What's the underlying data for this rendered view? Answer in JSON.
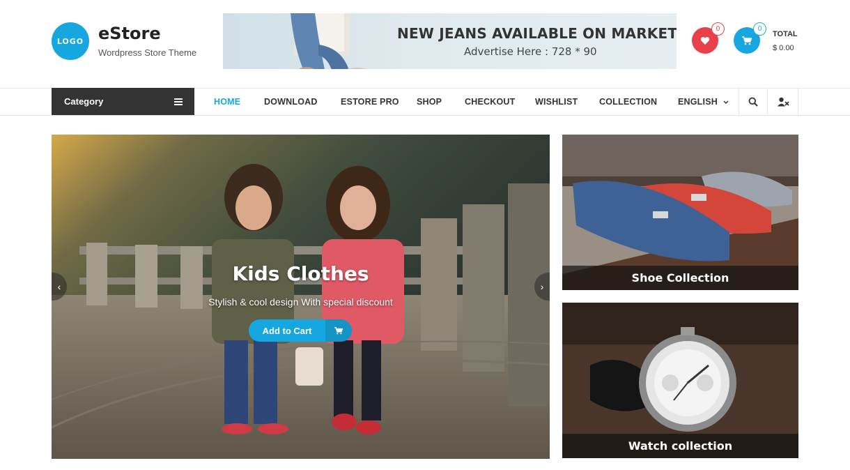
{
  "header": {
    "logo_text": "LOGO",
    "site_title": "eStore",
    "tagline": "Wordpress Store Theme",
    "ad": {
      "headline": "NEW JEANS AVAILABLE ON MARKET",
      "subline": "Advertise Here : 728 * 90"
    },
    "wishlist_count": "0",
    "cart_count": "0",
    "total_label": "TOTAL",
    "total_value": "$ 0.00"
  },
  "nav": {
    "category_label": "Category",
    "items": [
      {
        "label": "HOME",
        "active": true
      },
      {
        "label": "DOWNLOAD"
      },
      {
        "label": "ESTORE PRO"
      },
      {
        "label": "SHOP"
      },
      {
        "label": "CHECKOUT"
      },
      {
        "label": "WISHLIST"
      },
      {
        "label": "COLLECTION"
      },
      {
        "label": "ENGLISH"
      }
    ],
    "icons": [
      "search-icon",
      "user-icon"
    ]
  },
  "slider": {
    "title": "Kids Clothes",
    "subtitle": "Stylish & cool design With special discount",
    "button_label": "Add to Cart"
  },
  "promos": [
    {
      "caption": "Shoe Collection"
    },
    {
      "caption": "Watch collection"
    }
  ],
  "colors": {
    "accent": "#17a7e0",
    "wishlist": "#e8414a",
    "dark": "#333333"
  }
}
